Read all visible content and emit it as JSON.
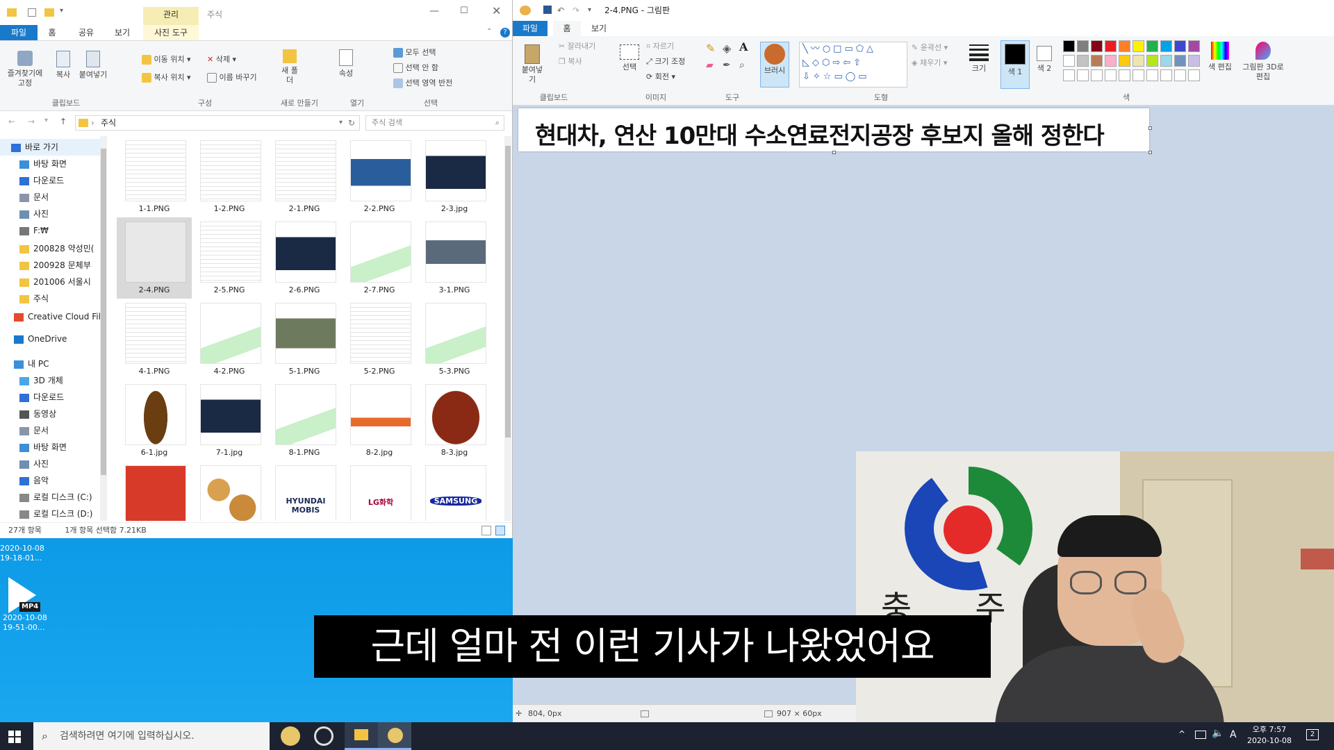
{
  "explorer": {
    "context_tab": "관리",
    "title": "주식",
    "tabs": [
      "파일",
      "홈",
      "공유",
      "보기",
      "사진 도구"
    ],
    "ribbon": {
      "pin": "즐겨찾기에 고정",
      "copy": "복사",
      "paste": "붙여넣기",
      "move_to": "이동 위치",
      "copy_to": "복사 위치",
      "delete": "삭제",
      "rename": "이름 바꾸기",
      "new_folder": "새 폴더",
      "properties": "속성",
      "select_all": "모두 선택",
      "select_none": "선택 안 함",
      "invert_selection": "선택 영역 반전",
      "groups": [
        "클립보드",
        "구성",
        "새로 만들기",
        "열기",
        "선택"
      ]
    },
    "address": "주식",
    "search_placeholder": "주식 검색",
    "nav": [
      {
        "label": "바로 가기",
        "icon": "star-icon"
      },
      {
        "label": "바탕 화면",
        "icon": "desktop-icon"
      },
      {
        "label": "다운로드",
        "icon": "download-icon"
      },
      {
        "label": "문서",
        "icon": "document-icon"
      },
      {
        "label": "사진",
        "icon": "picture-icon"
      },
      {
        "label": "F:₩",
        "icon": "drive-icon"
      },
      {
        "label": "200828 약성민(",
        "icon": "folder-icon"
      },
      {
        "label": "200928 문체부",
        "icon": "folder-icon"
      },
      {
        "label": "201006 서울시",
        "icon": "folder-icon"
      },
      {
        "label": "주식",
        "icon": "folder-icon"
      },
      {
        "label": "Creative Cloud Fil",
        "icon": "cloud-icon"
      },
      {
        "label": "OneDrive",
        "icon": "onedrive-icon"
      },
      {
        "label": "내 PC",
        "icon": "pc-icon"
      },
      {
        "label": "3D 개체",
        "icon": "cube-icon"
      },
      {
        "label": "다운로드",
        "icon": "download-icon"
      },
      {
        "label": "동영상",
        "icon": "video-icon"
      },
      {
        "label": "문서",
        "icon": "document-icon"
      },
      {
        "label": "바탕 화면",
        "icon": "desktop-icon"
      },
      {
        "label": "사진",
        "icon": "picture-icon"
      },
      {
        "label": "음악",
        "icon": "music-icon"
      },
      {
        "label": "로컬 디스크 (C:)",
        "icon": "disk-icon"
      },
      {
        "label": "로컬 디스크 (D:)",
        "icon": "disk-icon"
      }
    ],
    "files": [
      "1-1.PNG",
      "1-2.PNG",
      "2-1.PNG",
      "2-2.PNG",
      "2-3.jpg",
      "2-4.PNG",
      "2-5.PNG",
      "2-6.PNG",
      "2-7.PNG",
      "3-1.PNG",
      "4-1.PNG",
      "4-2.PNG",
      "5-1.PNG",
      "5-2.PNG",
      "5-3.PNG",
      "6-1.jpg",
      "7-1.jpg",
      "8-1.PNG",
      "8-2.jpg",
      "8-3.jpg",
      "",
      "",
      "",
      "",
      ""
    ],
    "thumb_labels": {
      "mobis": "HYUNDAI MOBIS",
      "lg": "LG화학",
      "samsung": "SAMSUNG"
    },
    "status_count": "27개 항목",
    "status_selected": "1개 항목 선택함 7.21KB"
  },
  "desktop": {
    "icon1_date": "2020-10-08",
    "icon1_time": "19-18-01...",
    "icon2_badge": "MP4",
    "icon2_date": "2020-10-08",
    "icon2_time": "19-51-00..."
  },
  "paint": {
    "title": "2-4.PNG - 그림판",
    "tabs": [
      "파일",
      "홈",
      "보기"
    ],
    "ribbon": {
      "paste": "붙여넣기",
      "cut": "잘라내기",
      "copy": "복사",
      "select": "선택",
      "crop": "자르기",
      "resize": "크기 조정",
      "rotate": "회전",
      "brush": "브러시",
      "outline": "윤곽선",
      "fill": "채우기",
      "size": "크기",
      "color1": "색 1",
      "color2": "색 2",
      "edit_colors": "색 편집",
      "paint3d": "그림판 3D로 편집",
      "groups": [
        "클립보드",
        "이미지",
        "도구",
        "도형",
        "색"
      ]
    },
    "canvas_text": "현대차, 연산 10만대 수소연료전지공장 후보지 올해 정한다",
    "cursor_pos": "804, 0px",
    "image_size": "907 × 60px",
    "palette": [
      "#000000",
      "#7f7f7f",
      "#880015",
      "#ed1c24",
      "#ff7f27",
      "#fff200",
      "#22b14c",
      "#00a2e8",
      "#3f48cc",
      "#a349a4",
      "#ffffff",
      "#c3c3c3",
      "#b97a57",
      "#ffaec9",
      "#ffc90e",
      "#efe4b0",
      "#b5e61d",
      "#99d9ea",
      "#7092be",
      "#c8bfe7"
    ]
  },
  "subtitle": "근데 얼마 전 이런 기사가 나왔었어요",
  "webcam": {
    "sign_text": "충 주 시"
  },
  "taskbar": {
    "search_placeholder": "검색하려면 여기에 입력하십시오.",
    "ime": "A",
    "time": "오후 7:57",
    "date": "2020-10-08",
    "notifications": "2"
  }
}
